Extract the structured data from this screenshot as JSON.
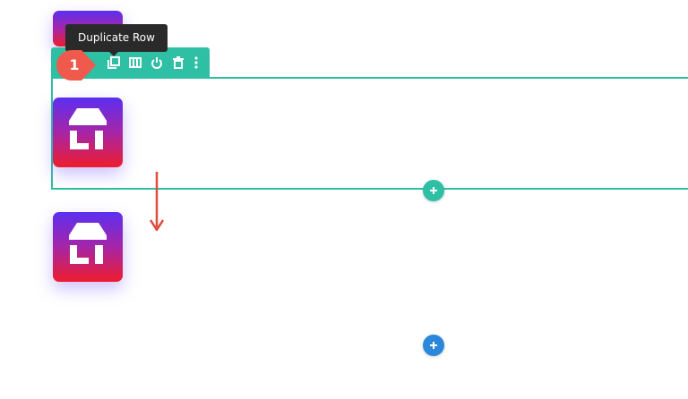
{
  "tooltip": {
    "text": "Duplicate Row"
  },
  "step_badge": {
    "number": "1"
  },
  "toolbar": {
    "buttons": [
      {
        "icon": "duplicate-icon"
      },
      {
        "icon": "columns-icon"
      },
      {
        "icon": "power-icon"
      },
      {
        "icon": "trash-icon"
      },
      {
        "icon": "more-vertical-icon"
      }
    ]
  },
  "colors": {
    "row_accent": "#2ebfa5",
    "section_add": "#2b87da",
    "badge": "#ef5a4c",
    "arrow": "#e04a3f",
    "tooltip_bg": "#2a2a2a",
    "tile_top": "#5b2ff0",
    "tile_bottom": "#ee1d2c"
  }
}
